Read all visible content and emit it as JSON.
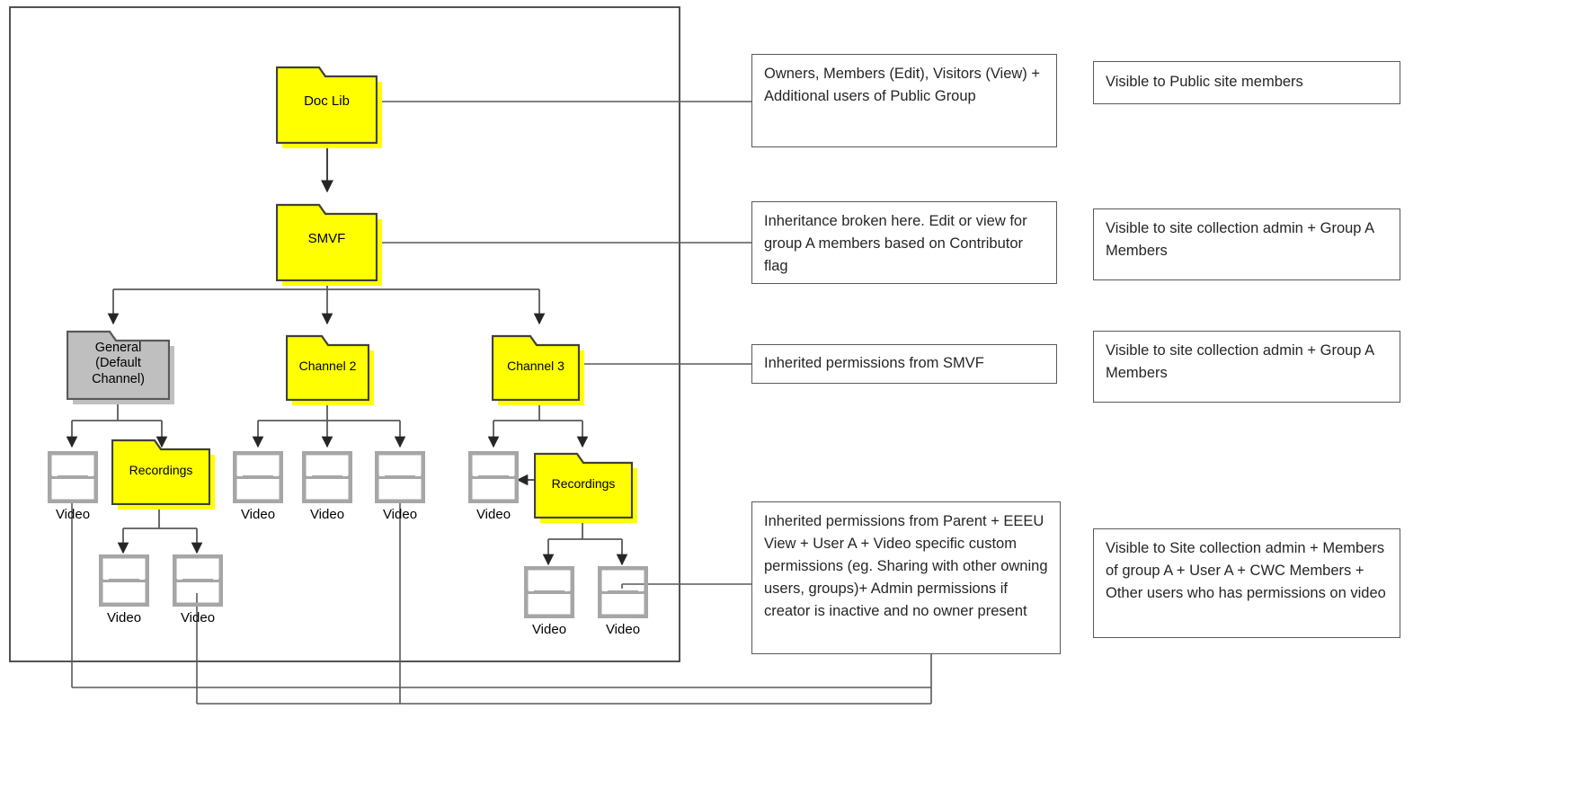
{
  "diagram": {
    "title": "SharePoint / Teams channel folder permission inheritance diagram",
    "colors": {
      "folder_fill": "#FFFF00",
      "folder_stroke": "#404040",
      "gray_fill": "#BFBFBF",
      "gray_stroke": "#595959",
      "line": "#595959",
      "arrow": "#404040",
      "note_border": "#595959",
      "note_text": "#262626",
      "film_icon": "#A6A6A6"
    },
    "nodes": [
      {
        "id": "doc-lib",
        "label": "Doc Lib",
        "type": "folder-yellow"
      },
      {
        "id": "smvf",
        "label": "SMVF",
        "type": "folder-yellow"
      },
      {
        "id": "general",
        "label": "General\n(Default\nChannel)",
        "type": "folder-gray"
      },
      {
        "id": "channel-2",
        "label": "Channel 2",
        "type": "folder-yellow"
      },
      {
        "id": "channel-3",
        "label": "Channel 3",
        "type": "folder-yellow"
      },
      {
        "id": "recordings-1",
        "label": "Recordings",
        "type": "folder-yellow"
      },
      {
        "id": "recordings-2",
        "label": "Recordings",
        "type": "folder-yellow"
      }
    ],
    "videos": [
      {
        "id": "video-general-1",
        "label": "Video"
      },
      {
        "id": "video-rec1-1",
        "label": "Video"
      },
      {
        "id": "video-rec1-2",
        "label": "Video"
      },
      {
        "id": "video-ch2-1",
        "label": "Video"
      },
      {
        "id": "video-ch2-2",
        "label": "Video"
      },
      {
        "id": "video-ch2-3",
        "label": "Video"
      },
      {
        "id": "video-ch3-1",
        "label": "Video"
      },
      {
        "id": "video-rec2-1",
        "label": "Video"
      },
      {
        "id": "video-rec2-2",
        "label": "Video"
      }
    ],
    "notes": {
      "doc_lib": "Owners, Members (Edit), Visitors (View) + Additional users of Public Group",
      "smvf": "Inheritance broken here. Edit or view for group A members based on Contributor flag",
      "channel": "Inherited permissions from SMVF",
      "video": "Inherited permissions from Parent + EEEU View + User A + Video specific custom permissions (eg. Sharing with other owning users, groups)+ Admin permissions if creator is inactive and no owner present"
    },
    "visibility": {
      "doc_lib": "Visible to Public site members",
      "smvf": "Visible to site collection admin + Group A Members",
      "channel": "Visible to site collection admin + Group A Members",
      "video": "Visible to Site collection admin + Members of group A + User A + CWC Members + Other users who has permissions on video"
    }
  }
}
